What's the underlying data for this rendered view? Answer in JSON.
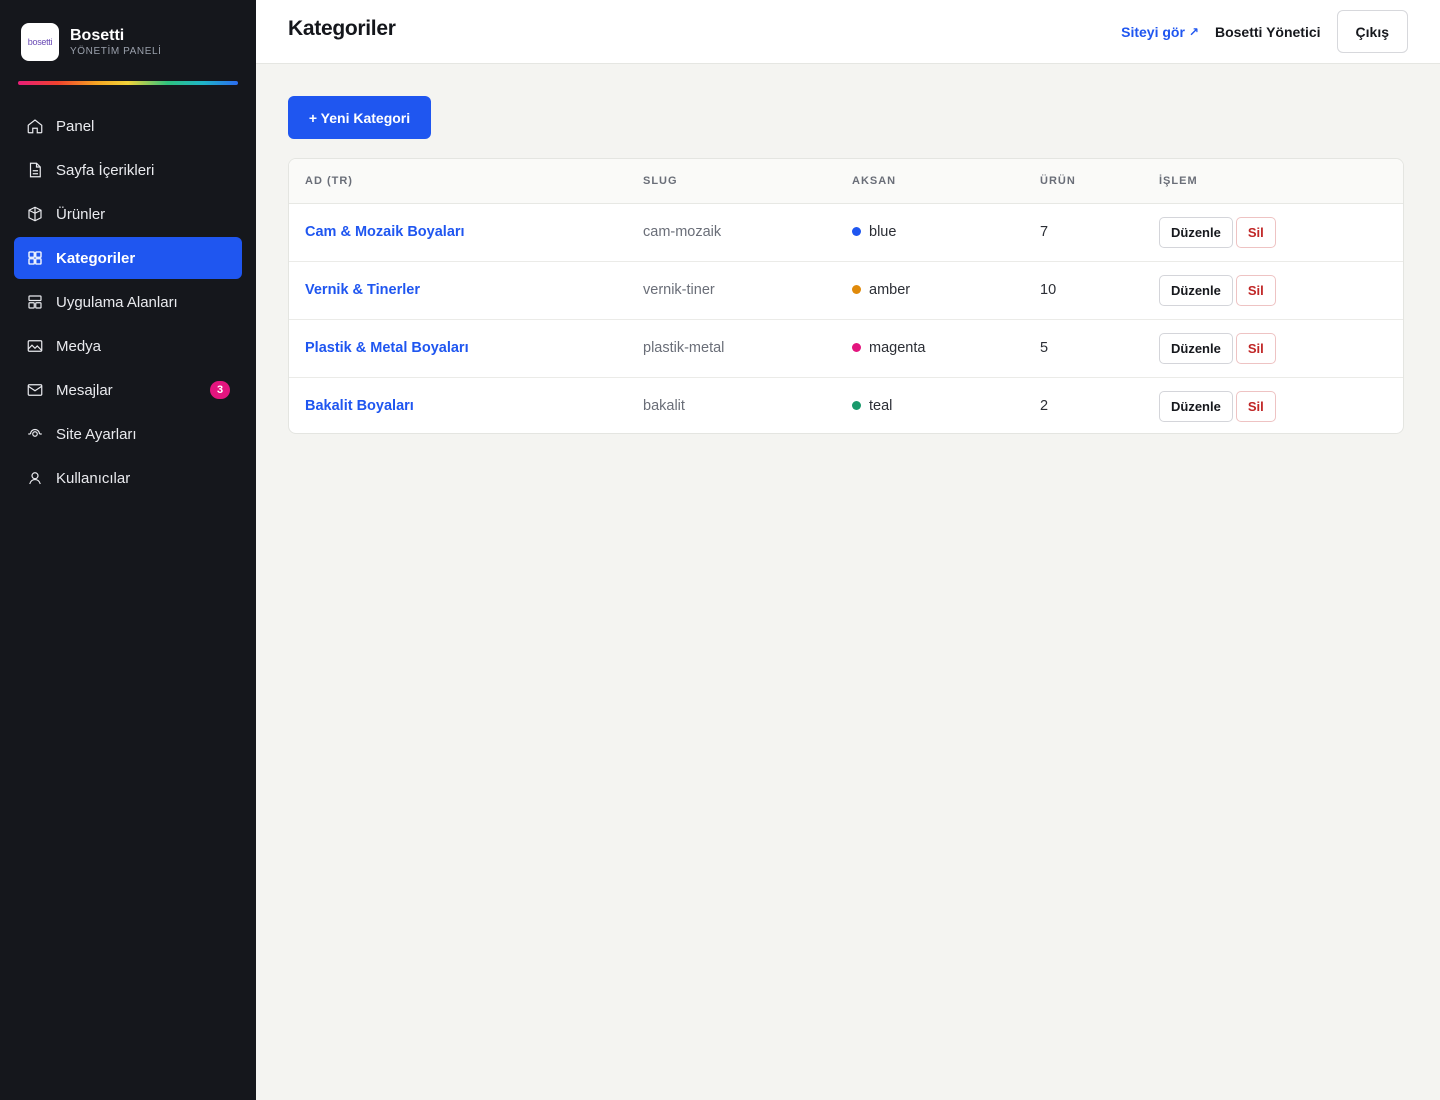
{
  "brand": {
    "logo_text": "bosetti",
    "name": "Bosetti",
    "subtitle": "YÖNETİM PANELİ"
  },
  "sidebar": {
    "items": [
      {
        "label": "Panel",
        "icon": "home-icon",
        "active": false
      },
      {
        "label": "Sayfa İçerikleri",
        "icon": "document-icon",
        "active": false
      },
      {
        "label": "Ürünler",
        "icon": "box-icon",
        "active": false
      },
      {
        "label": "Kategoriler",
        "icon": "grid-icon",
        "active": true
      },
      {
        "label": "Uygulama Alanları",
        "icon": "layout-icon",
        "active": false
      },
      {
        "label": "Medya",
        "icon": "image-icon",
        "active": false
      },
      {
        "label": "Mesajlar",
        "icon": "mail-icon",
        "active": false,
        "badge": "3"
      },
      {
        "label": "Site Ayarları",
        "icon": "settings-icon",
        "active": false
      },
      {
        "label": "Kullanıcılar",
        "icon": "user-icon",
        "active": false
      }
    ]
  },
  "header": {
    "title": "Kategoriler",
    "site_link": "Siteyi gör",
    "site_link_arrow": "↗",
    "user": "Bosetti Yönetici",
    "logout": "Çıkış"
  },
  "main": {
    "new_button": "+ Yeni Kategori",
    "table": {
      "columns": [
        "AD (TR)",
        "SLUG",
        "AKSAN",
        "ÜRÜN",
        "İŞLEM"
      ],
      "rows": [
        {
          "name": "Cam & Mozaik Boyaları",
          "slug": "cam-mozaik",
          "accent": "blue",
          "accent_color": "#1f56f0",
          "count": "7"
        },
        {
          "name": "Vernik & Tinerler",
          "slug": "vernik-tiner",
          "accent": "amber",
          "accent_color": "#e08a0b",
          "count": "10"
        },
        {
          "name": "Plastik & Metal Boyaları",
          "slug": "plastik-metal",
          "accent": "magenta",
          "accent_color": "#e3157e",
          "count": "5"
        },
        {
          "name": "Bakalit Boyaları",
          "slug": "bakalit",
          "accent": "teal",
          "accent_color": "#1a9a6c",
          "count": "2"
        }
      ],
      "edit_label": "Düzenle",
      "delete_label": "Sil"
    }
  },
  "colors": {
    "sidebar_bg": "#15171c",
    "accent": "#1f56f0",
    "danger": "#c02626"
  }
}
